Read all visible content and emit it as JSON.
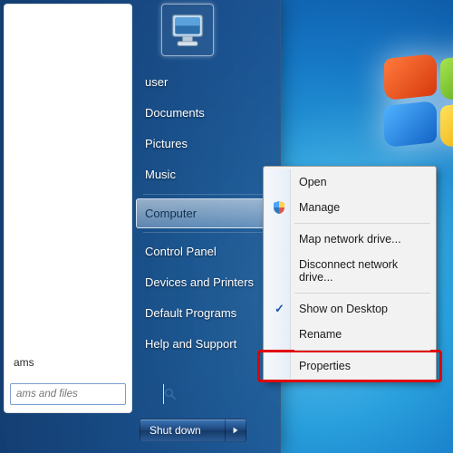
{
  "start_menu": {
    "user_items": [
      {
        "label": "user"
      },
      {
        "label": "Documents"
      },
      {
        "label": "Pictures"
      },
      {
        "label": "Music"
      }
    ],
    "computer_label": "Computer",
    "system_items": [
      {
        "label": "Control Panel"
      },
      {
        "label": "Devices and Printers"
      },
      {
        "label": "Default Programs"
      },
      {
        "label": "Help and Support"
      }
    ],
    "all_programs_label": "ams",
    "search_placeholder": "ams and files",
    "shutdown_label": "Shut down"
  },
  "context_menu": {
    "items": [
      {
        "label": "Open"
      },
      {
        "label": "Manage",
        "icon": "shield"
      },
      {
        "sep": true
      },
      {
        "label": "Map network drive..."
      },
      {
        "label": "Disconnect network drive..."
      },
      {
        "sep": true
      },
      {
        "label": "Show on Desktop",
        "checked": true
      },
      {
        "label": "Rename"
      },
      {
        "sep": true
      },
      {
        "label": "Properties",
        "highlight": true
      }
    ]
  },
  "icons": {
    "user_picture": "computer-monitor-icon",
    "search": "magnifier-icon",
    "shield": "shield-icon",
    "arrow": "triangle-right-icon"
  }
}
